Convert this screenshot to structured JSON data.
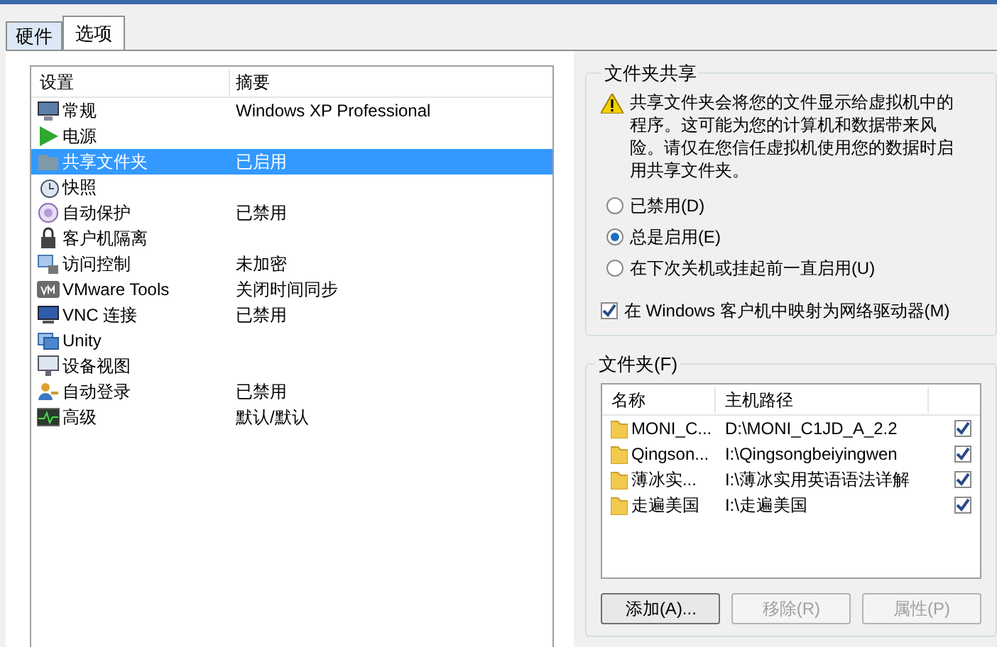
{
  "tabs": [
    {
      "label": "硬件",
      "selected": false
    },
    {
      "label": "选项",
      "selected": true
    }
  ],
  "settings": {
    "columns": [
      "设置",
      "摘要"
    ],
    "rows": [
      {
        "name": "常规",
        "summary": "Windows XP Professional",
        "selected": false
      },
      {
        "name": "电源",
        "summary": "",
        "selected": false
      },
      {
        "name": "共享文件夹",
        "summary": "已启用",
        "selected": true
      },
      {
        "name": "快照",
        "summary": "",
        "selected": false
      },
      {
        "name": "自动保护",
        "summary": "已禁用",
        "selected": false
      },
      {
        "name": "客户机隔离",
        "summary": "",
        "selected": false
      },
      {
        "name": "访问控制",
        "summary": "未加密",
        "selected": false
      },
      {
        "name": "VMware Tools",
        "summary": "关闭时间同步",
        "selected": false
      },
      {
        "name": "VNC 连接",
        "summary": "已禁用",
        "selected": false
      },
      {
        "name": "Unity",
        "summary": "",
        "selected": false
      },
      {
        "name": "设备视图",
        "summary": "",
        "selected": false
      },
      {
        "name": "自动登录",
        "summary": "已禁用",
        "selected": false
      },
      {
        "name": "高级",
        "summary": "默认/默认",
        "selected": false
      }
    ]
  },
  "sharing": {
    "title": "文件夹共享",
    "warning": "共享文件夹会将您的文件显示给虚拟机中的程序。这可能为您的计算机和数据带来风险。请仅在您信任虚拟机使用您的数据时启用共享文件夹。",
    "options": [
      {
        "label": "已禁用(D)",
        "selected": false
      },
      {
        "label": "总是启用(E)",
        "selected": true
      },
      {
        "label": "在下次关机或挂起前一直启用(U)",
        "selected": false
      }
    ],
    "map_drive": {
      "label": "在 Windows 客户机中映射为网络驱动器(M)",
      "checked": true
    }
  },
  "folders": {
    "title": "文件夹(F)",
    "columns": [
      "名称",
      "主机路径"
    ],
    "rows": [
      {
        "name": "MONI_C...",
        "path": "D:\\MONI_C1JD_A_2.2",
        "checked": true
      },
      {
        "name": "Qingson...",
        "path": "I:\\Qingsongbeiyingwen",
        "checked": true
      },
      {
        "name": "薄冰实...",
        "path": "I:\\薄冰实用英语语法详解",
        "checked": true
      },
      {
        "name": "走遍美国",
        "path": "I:\\走遍美国",
        "checked": true
      }
    ],
    "buttons": [
      {
        "label": "添加(A)...",
        "disabled": false
      },
      {
        "label": "移除(R)",
        "disabled": true
      },
      {
        "label": "属性(P)",
        "disabled": true
      }
    ]
  }
}
